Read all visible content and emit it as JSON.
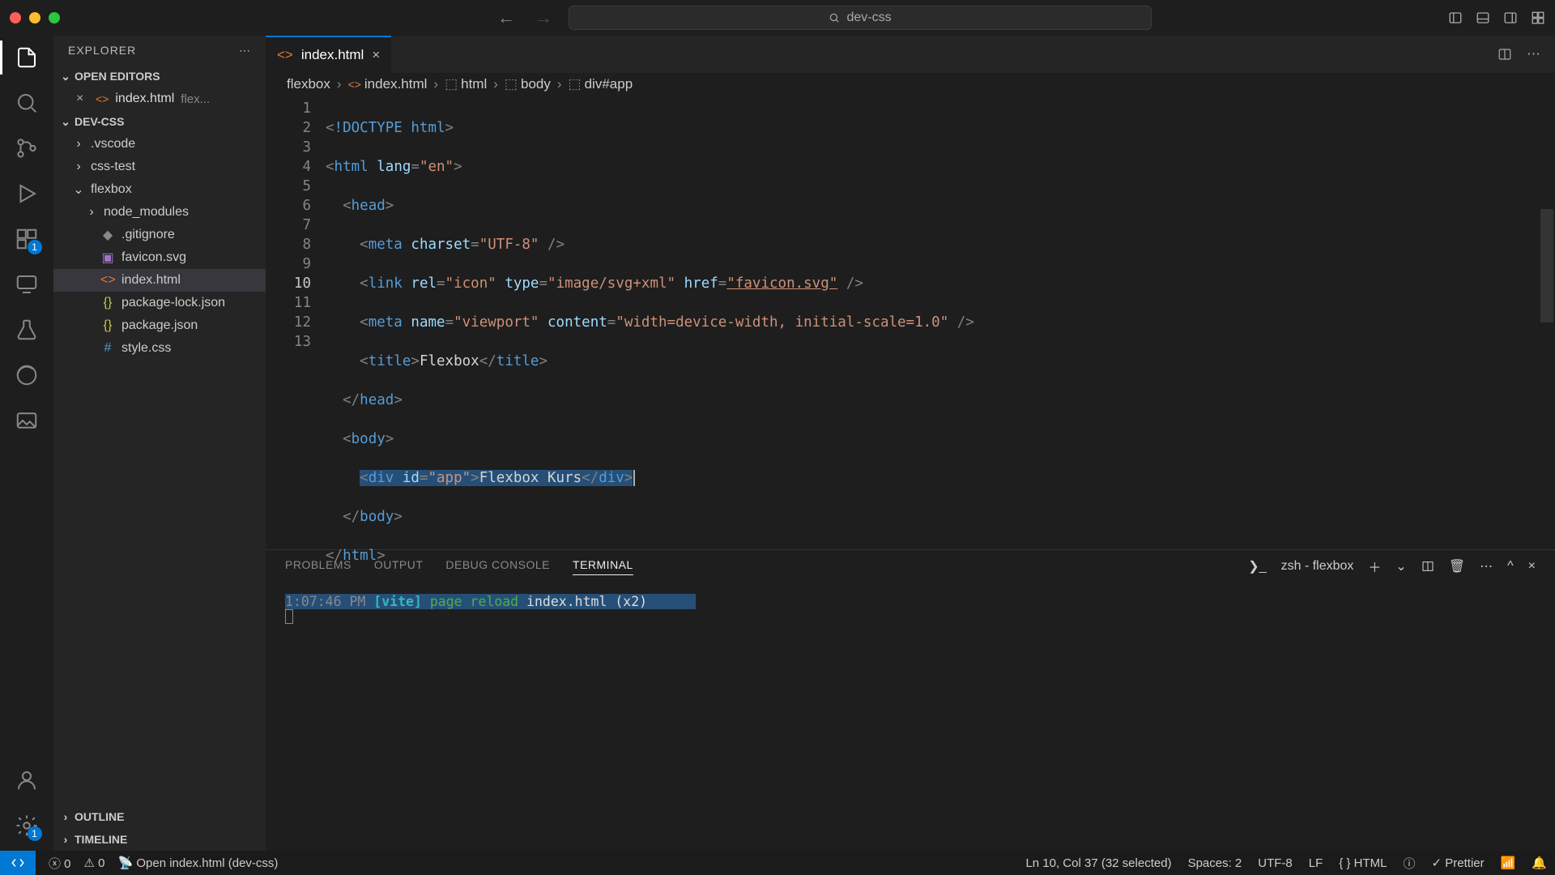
{
  "title_bar": {
    "search_text": "dev-css"
  },
  "sidebar": {
    "explorer_label": "EXPLORER",
    "sections": {
      "open_editors": "OPEN EDITORS",
      "project": "DEV-CSS",
      "outline": "OUTLINE",
      "timeline": "TIMELINE"
    },
    "open_editors": [
      {
        "name": "index.html",
        "dir_hint": "flex..."
      }
    ],
    "tree": [
      {
        "name": ".vscode",
        "type": "folder",
        "indent": 0
      },
      {
        "name": "css-test",
        "type": "folder",
        "indent": 0
      },
      {
        "name": "flexbox",
        "type": "folder",
        "indent": 0,
        "expanded": true
      },
      {
        "name": "node_modules",
        "type": "folder",
        "indent": 1
      },
      {
        "name": ".gitignore",
        "type": "git",
        "indent": 1
      },
      {
        "name": "favicon.svg",
        "type": "svg",
        "indent": 1
      },
      {
        "name": "index.html",
        "type": "html",
        "indent": 1,
        "selected": true
      },
      {
        "name": "package-lock.json",
        "type": "json",
        "indent": 1
      },
      {
        "name": "package.json",
        "type": "json",
        "indent": 1
      },
      {
        "name": "style.css",
        "type": "css",
        "indent": 1
      }
    ]
  },
  "tabs": {
    "active": "index.html"
  },
  "breadcrumbs": [
    {
      "label": "flexbox",
      "kind": "folder"
    },
    {
      "label": "index.html",
      "kind": "file"
    },
    {
      "label": "html",
      "kind": "symbol"
    },
    {
      "label": "body",
      "kind": "symbol"
    },
    {
      "label": "div#app",
      "kind": "symbol"
    }
  ],
  "code": {
    "lines": [
      {
        "n": 1
      },
      {
        "n": 2
      },
      {
        "n": 3
      },
      {
        "n": 4
      },
      {
        "n": 5
      },
      {
        "n": 6
      },
      {
        "n": 7
      },
      {
        "n": 8
      },
      {
        "n": 9
      },
      {
        "n": 10,
        "current": true
      },
      {
        "n": 11
      },
      {
        "n": 12
      },
      {
        "n": 13
      }
    ],
    "tokens": {
      "doctype": "!DOCTYPE",
      "html_word": "html",
      "lang_attr": "lang",
      "lang_val": "\"en\"",
      "head": "head",
      "meta": "meta",
      "charset_attr": "charset",
      "charset_val": "\"UTF-8\"",
      "link": "link",
      "rel_attr": "rel",
      "rel_val": "\"icon\"",
      "type_attr": "type",
      "type_val": "\"image/svg+xml\"",
      "href_attr": "href",
      "href_val": "\"favicon.svg\"",
      "name_attr": "name",
      "name_val": "\"viewport\"",
      "content_attr": "content",
      "content_val": "\"width=device-width, initial-scale=1.0\"",
      "title_tag": "title",
      "title_text": "Flexbox",
      "body": "body",
      "div": "div",
      "id_attr": "id",
      "id_val": "\"app\"",
      "div_text": "Flexbox Kurs"
    }
  },
  "panel": {
    "tabs": [
      "PROBLEMS",
      "OUTPUT",
      "DEBUG CONSOLE",
      "TERMINAL"
    ],
    "active": "TERMINAL",
    "shell_label": "zsh - flexbox",
    "term": {
      "time": "1:07:46 PM",
      "vite": "[vite]",
      "page": "page",
      "reload": "reload",
      "rest": "index.html (x2)"
    }
  },
  "status": {
    "errors": "0",
    "warnings": "0",
    "open_file": "Open index.html (dev-css)",
    "selection": "Ln 10, Col 37 (32 selected)",
    "spaces": "Spaces: 2",
    "encoding": "UTF-8",
    "eol": "LF",
    "lang": "HTML",
    "prettier": "Prettier"
  },
  "activity_badge": "1"
}
